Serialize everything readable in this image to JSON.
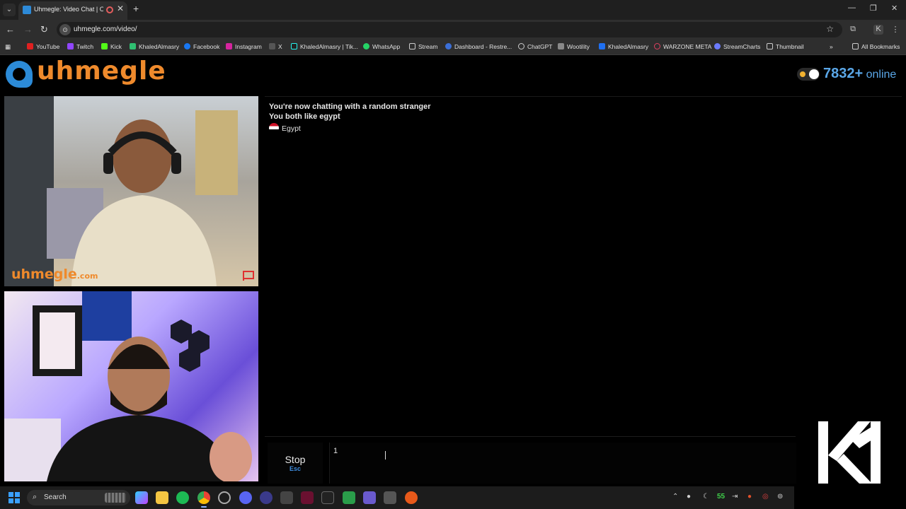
{
  "browser": {
    "tab_title": "Uhmegle: Video Chat | Om",
    "url": "uhmegle.com/video/",
    "bookmarks": [
      "YouTube",
      "Twitch",
      "Kick",
      "KhaledAlmasry",
      "Facebook",
      "Instagram",
      "X",
      "KhaledAlmasry | Tik...",
      "WhatsApp",
      "Stream",
      "Dashboard - Restre...",
      "ChatGPT",
      "Wootility",
      "KhaledAlmasry",
      "WARZONE META",
      "StreamCharts",
      "Thumbnail"
    ],
    "all_bookmarks": "All Bookmarks"
  },
  "site": {
    "logo_text": "uhmegle",
    "online_count": "7832+",
    "online_word": "online",
    "watermark_main": "uhmegle",
    "watermark_suffix": ".com"
  },
  "chat": {
    "status_line": "You're now chatting with a random stranger",
    "interest_line": "You both like egypt",
    "country": "Egypt",
    "input_value": "1",
    "stop_label": "Stop",
    "stop_key": "Esc"
  },
  "taskbar": {
    "search_label": "Search",
    "tray_number": "55"
  },
  "colors": {
    "accent_orange": "#ef8a2c",
    "accent_blue": "#5aa7e8"
  }
}
